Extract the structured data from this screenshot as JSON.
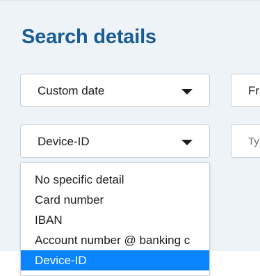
{
  "heading": "Search details",
  "date_select": {
    "value": "Custom date"
  },
  "from_field": {
    "text": "Fr"
  },
  "detail_select": {
    "value": "Device-ID",
    "options": [
      "No specific detail",
      "Card number",
      "IBAN",
      "Account number @ banking c",
      "Device-ID"
    ],
    "selected_index": 4
  },
  "type_field": {
    "placeholder": "Ty"
  },
  "colors": {
    "heading": "#1a5c97",
    "panel_bg": "#eef3f8",
    "selected_bg": "#0a84ff",
    "border": "#c7d0da"
  }
}
